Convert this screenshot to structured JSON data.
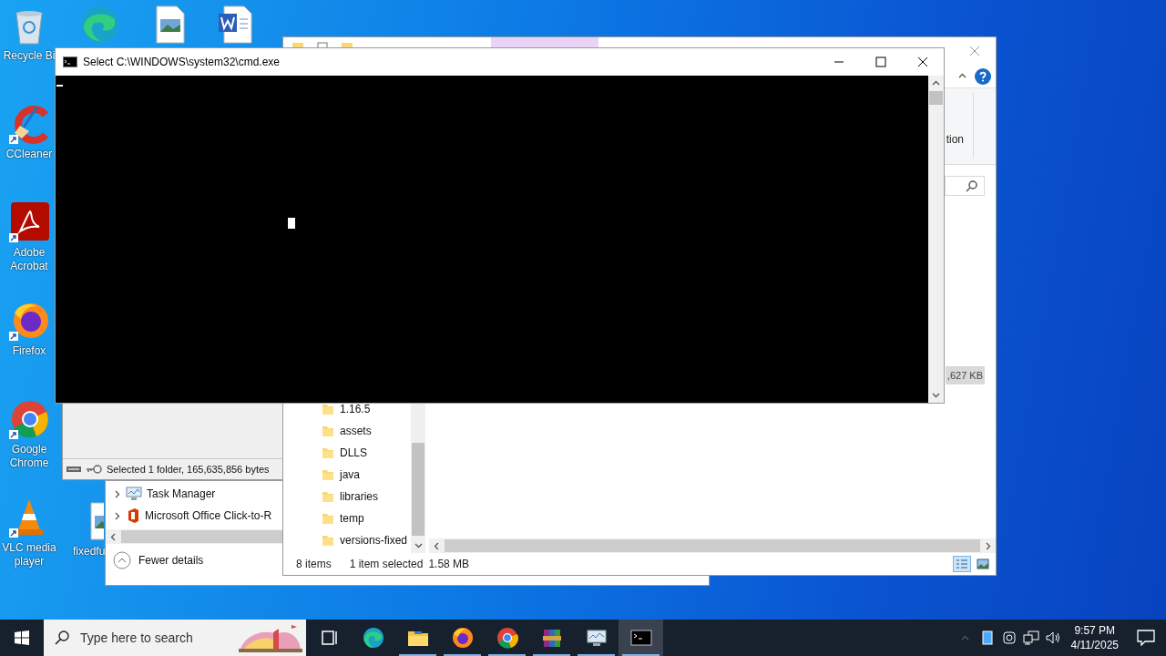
{
  "desktop": {
    "icons": [
      {
        "kind": "recycle-bin",
        "label": "Recycle Bi"
      },
      {
        "kind": "ccleaner",
        "label": "CCleaner"
      },
      {
        "kind": "acrobat",
        "label": "Adobe Acrobat"
      },
      {
        "kind": "firefox",
        "label": "Firefox"
      },
      {
        "kind": "chrome",
        "label": "Google Chrome"
      },
      {
        "kind": "vlc",
        "label": "VLC media player"
      }
    ],
    "top_icons": [
      {
        "kind": "edge"
      },
      {
        "kind": "image-file"
      },
      {
        "kind": "word-doc"
      }
    ],
    "bottom_icon": {
      "kind": "image-file",
      "label": "fixedfu"
    }
  },
  "archive_window": {
    "status": "Selected 1 folder, 165,635,856 bytes"
  },
  "task_manager": {
    "processes": [
      {
        "name": "Task Manager",
        "kind": "monitor",
        "expanded": false
      },
      {
        "name": "Microsoft Office Click-to-R",
        "kind": "office",
        "expanded": false
      }
    ],
    "footer": "Fewer details"
  },
  "explorer": {
    "ribbon_fragment": "tion",
    "size_fragment": ",627 KB",
    "folders": [
      "1.16.5",
      "assets",
      "DLLS",
      "java",
      "libraries",
      "temp",
      "versions-fixed"
    ],
    "status": {
      "count": "8 items",
      "selection": "1 item selected",
      "size": "1.58 MB"
    },
    "views": [
      {
        "kind": "details",
        "selected": true
      },
      {
        "kind": "thumbnails",
        "selected": false
      }
    ]
  },
  "console": {
    "title": "Select C:\\WINDOWS\\system32\\cmd.exe"
  },
  "taskbar": {
    "search": {
      "placeholder": "Type here to search"
    },
    "apps": [
      {
        "kind": "task-view",
        "running": false,
        "selected": false
      },
      {
        "kind": "edge",
        "running": false,
        "selected": false
      },
      {
        "kind": "explorer",
        "running": true,
        "selected": false
      },
      {
        "kind": "firefox",
        "running": true,
        "selected": false
      },
      {
        "kind": "chrome",
        "running": true,
        "selected": false
      },
      {
        "kind": "winrar",
        "running": true,
        "selected": false
      },
      {
        "kind": "taskmgr",
        "running": true,
        "selected": false
      },
      {
        "kind": "cmd",
        "running": true,
        "selected": true
      }
    ],
    "time": "9:57 PM",
    "date": "4/11/2025"
  }
}
